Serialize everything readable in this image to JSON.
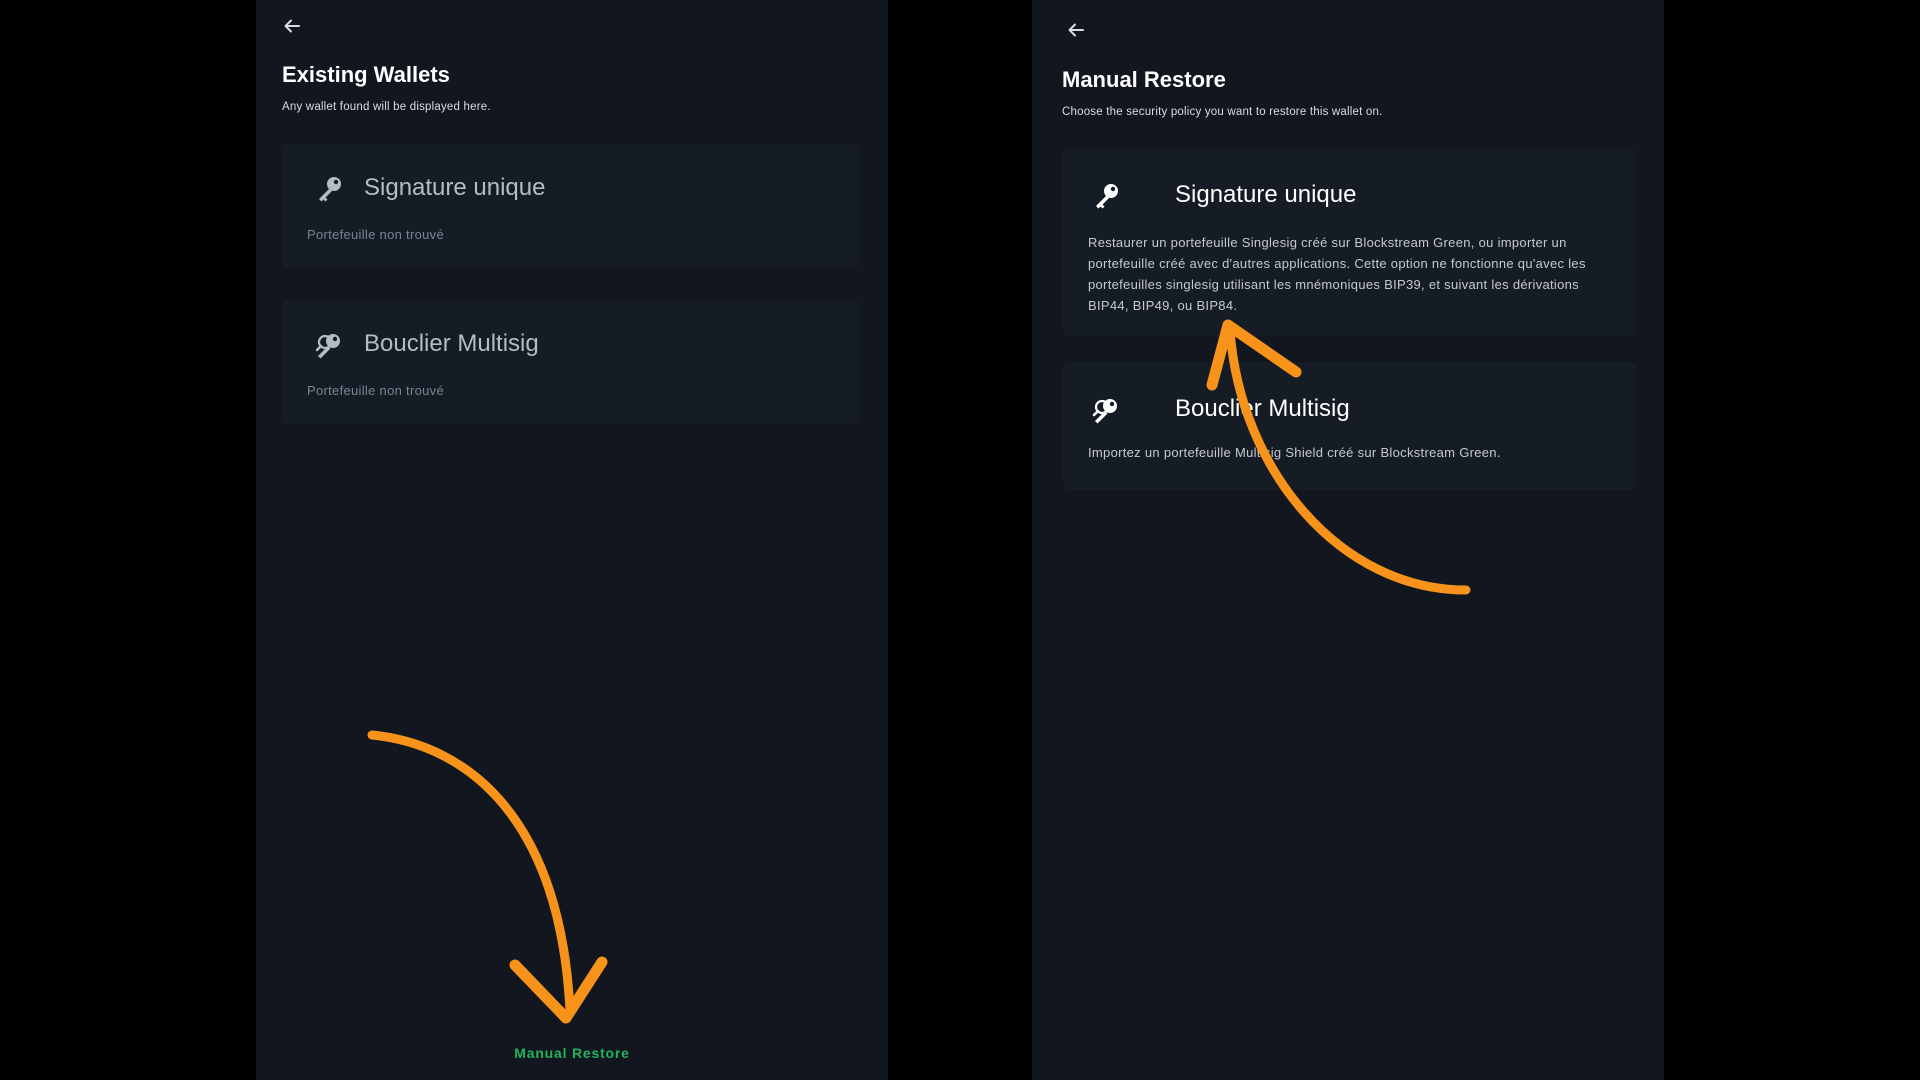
{
  "left_screen": {
    "title": "Existing Wallets",
    "subtitle": "Any wallet found will be displayed here.",
    "back_icon": "arrow-left-icon",
    "cards": [
      {
        "icon": "key-icon",
        "title": "Signature unique",
        "status": "Portefeuille non trouvé"
      },
      {
        "icon": "keys-icon",
        "title": "Bouclier Multisig",
        "status": "Portefeuille non trouvé"
      }
    ],
    "manual_restore_label": "Manual Restore"
  },
  "right_screen": {
    "title": "Manual Restore",
    "subtitle": "Choose the security policy you want to restore this wallet on.",
    "back_icon": "arrow-left-icon",
    "cards": [
      {
        "icon": "key-icon",
        "title": "Signature unique",
        "description": "Restaurer un portefeuille Singlesig créé sur Blockstream Green, ou importer un portefeuille créé avec d'autres applications. Cette option ne fonctionne qu'avec les portefeuilles singlesig utilisant les mnémoniques BIP39, et suivant les dérivations BIP44, BIP49, ou BIP84."
      },
      {
        "icon": "keys-icon",
        "title": "Bouclier Multisig",
        "description": "Importez un portefeuille Multisig Shield créé sur Blockstream Green."
      }
    ]
  },
  "colors": {
    "background": "#000000",
    "panel": "#11161f",
    "card": "#161c26",
    "accent_green": "#25b35d",
    "annotation_orange": "#f7931a"
  }
}
